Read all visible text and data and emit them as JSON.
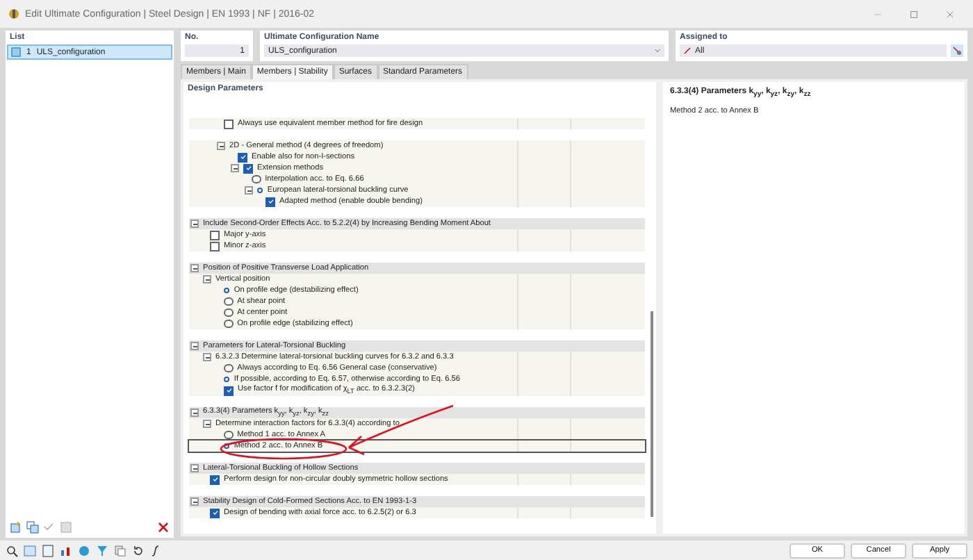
{
  "window": {
    "title": "Edit Ultimate Configuration | Steel Design | EN 1993 | NF | 2016-02"
  },
  "list": {
    "title": "List",
    "items": [
      {
        "number": "1",
        "label": "ULS_configuration",
        "selected": true
      }
    ]
  },
  "number": {
    "label": "No.",
    "value": "1"
  },
  "name": {
    "label": "Ultimate Configuration Name",
    "value": "ULS_configuration"
  },
  "assigned": {
    "label": "Assigned to",
    "value": "All"
  },
  "tabs": [
    {
      "label": "Members | Main",
      "selected": false
    },
    {
      "label": "Members | Stability",
      "selected": true
    },
    {
      "label": "Surfaces",
      "selected": false
    },
    {
      "label": "Standard Parameters",
      "selected": false
    }
  ],
  "design_parameters": {
    "title": "Design Parameters",
    "sections": [
      {
        "items": [
          {
            "kind": "checkbox",
            "label": "Always use equivalent member method for fire design",
            "checked": false
          }
        ]
      },
      {
        "items": [
          {
            "kind": "node",
            "label": "2D - General method (4 degrees of freedom)",
            "expanded": true,
            "children": [
              {
                "kind": "checkbox",
                "label": "Enable also for non-I-sections",
                "checked": true
              },
              {
                "kind": "checkbox",
                "label": "Extension methods",
                "checked": true,
                "expanded": true,
                "children": [
                  {
                    "kind": "radio",
                    "label": "Interpolation acc. to Eq. 6.66",
                    "selected": false
                  },
                  {
                    "kind": "radio",
                    "label": "European lateral-torsional buckling curve",
                    "selected": true,
                    "expanded": true,
                    "children": [
                      {
                        "kind": "checkbox",
                        "label": "Adapted method (enable double bending)",
                        "checked": true
                      }
                    ]
                  }
                ]
              }
            ]
          }
        ]
      },
      {
        "title": "Include Second-Order Effects Acc. to 5.2.2(4) by Increasing Bending Moment About",
        "expanded": true,
        "items": [
          {
            "kind": "checkbox",
            "label": "Major y-axis",
            "checked": false
          },
          {
            "kind": "checkbox",
            "label": "Minor z-axis",
            "checked": false
          }
        ]
      },
      {
        "title": "Position of Positive Transverse Load Application",
        "expanded": true,
        "items": [
          {
            "kind": "node",
            "label": "Vertical position",
            "expanded": true,
            "children": [
              {
                "kind": "radio",
                "label": "On profile edge (destabilizing effect)",
                "selected": true
              },
              {
                "kind": "radio",
                "label": "At shear point",
                "selected": false
              },
              {
                "kind": "radio",
                "label": "At center point",
                "selected": false
              },
              {
                "kind": "radio",
                "label": "On profile edge (stabilizing effect)",
                "selected": false
              }
            ]
          }
        ]
      },
      {
        "title": "Parameters for Lateral-Torsional Buckling",
        "expanded": true,
        "items": [
          {
            "kind": "node",
            "label": "6.3.2.3 Determine lateral-torsional buckling curves for 6.3.2 and 6.3.3",
            "expanded": true,
            "children": [
              {
                "kind": "radio",
                "label": "Always according to Eq. 6.56 General case (conservative)",
                "selected": false
              },
              {
                "kind": "radio",
                "label": "If possible, according to Eq. 6.57, otherwise according to Eq. 6.56",
                "selected": true
              },
              {
                "kind": "checkbox",
                "label": "Use factor f for modification of χ$_{LT}$ acc. to 6.3.2.3(2)",
                "checked": true
              }
            ]
          }
        ]
      },
      {
        "title": "6.3.3(4) Parameters k$_{yy}$, k$_{yz}$, k$_{zy}$, k$_{zz}$",
        "expanded": true,
        "items": [
          {
            "kind": "node",
            "label": "Determine interaction factors for 6.3.3(4) according to",
            "expanded": true,
            "children": [
              {
                "kind": "radio",
                "label": "Method 1 acc. to Annex A",
                "selected": false
              },
              {
                "kind": "radio",
                "label": "Method 2 acc. to Annex B",
                "selected": true,
                "focused": true
              }
            ]
          }
        ]
      },
      {
        "title": "Lateral-Torsional Buckling of Hollow Sections",
        "expanded": true,
        "items": [
          {
            "kind": "checkbox",
            "label": "Perform design for non-circular doubly symmetric hollow sections",
            "checked": true
          }
        ]
      },
      {
        "title": "Stability Design of Cold-Formed Sections Acc. to EN 1993-1-3",
        "expanded": true,
        "items": [
          {
            "kind": "checkbox",
            "label": "Design of bending with axial force acc. to 6.2.5(2) or 6.3",
            "checked": true
          }
        ]
      }
    ]
  },
  "info": {
    "title": "6.3.3(4) Parameters k$_{yy}$, k$_{yz}$, k$_{zy}$, k$_{zz}$",
    "text": "Method 2 acc. to Annex B"
  },
  "buttons": [
    {
      "label": "OK"
    },
    {
      "label": "Cancel"
    },
    {
      "label": "Apply"
    }
  ]
}
